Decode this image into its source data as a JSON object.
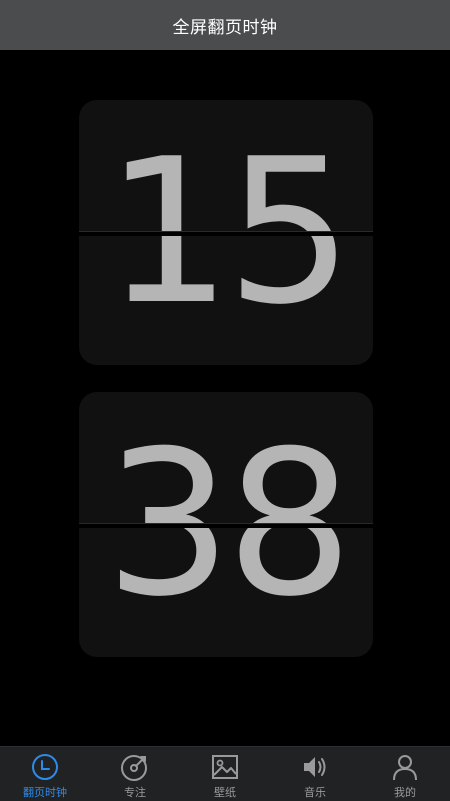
{
  "header": {
    "title": "全屏翻页时钟"
  },
  "clock": {
    "hours": "15",
    "minutes": "38"
  },
  "tabs": [
    {
      "label": "翻页时钟",
      "icon": "clock-icon",
      "active": true
    },
    {
      "label": "专注",
      "icon": "focus-icon",
      "active": false
    },
    {
      "label": "壁纸",
      "icon": "image-icon",
      "active": false
    },
    {
      "label": "音乐",
      "icon": "speaker-icon",
      "active": false
    },
    {
      "label": "我的",
      "icon": "user-icon",
      "active": false
    }
  ],
  "colors": {
    "accent": "#2f8be8",
    "inactive": "#9a9a9a",
    "digit": "#b5b5b5",
    "card": "#111111",
    "header": "#4a4c4e",
    "tabbar": "#212224"
  }
}
